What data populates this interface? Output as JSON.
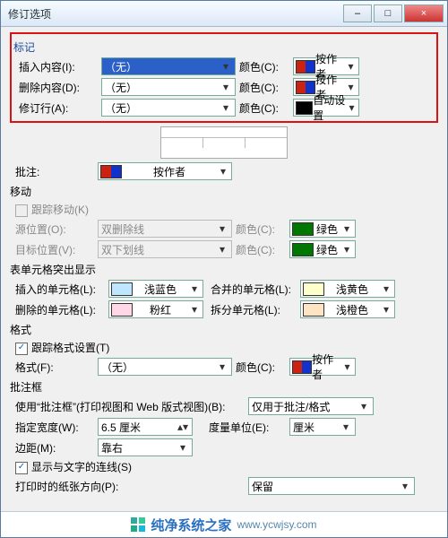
{
  "title": "修订选项",
  "winbuttons": {
    "min": "–",
    "max": "□",
    "close": "×"
  },
  "sections": {
    "mark": "标记",
    "annot": "批注:",
    "move": "移动",
    "cellHighlight": "表单元格突出显示",
    "format": "格式",
    "balloon": "批注框"
  },
  "mark": {
    "insertLbl": "插入内容(I):",
    "insertVal": "（无）",
    "insertColorLbl": "颜色(C):",
    "insertColorTxt": "按作者",
    "deleteLbl": "删除内容(D):",
    "deleteVal": "（无）",
    "deleteColorLbl": "颜色(C):",
    "deleteColorTxt": "按作者",
    "revLbl": "修订行(A):",
    "revVal": "（无）",
    "revColorLbl": "颜色(C):",
    "revColorTxt": "自动设置"
  },
  "annot": {
    "val": "按作者"
  },
  "move": {
    "trackLbl": "跟踪移动(K)",
    "srcLbl": "源位置(O):",
    "srcVal": "双删除线",
    "srcColorLbl": "颜色(C):",
    "srcColorTxt": "绿色",
    "tgtLbl": "目标位置(V):",
    "tgtVal": "双下划线",
    "tgtColorLbl": "颜色(C):",
    "tgtColorTxt": "绿色"
  },
  "cell": {
    "insertedLbl": "插入的单元格(L):",
    "insertedTxt": "浅蓝色",
    "mergedLbl": "合并的单元格(L):",
    "mergedTxt": "浅黄色",
    "deletedLbl": "删除的单元格(L):",
    "deletedTxt": "粉红",
    "splitLbl": "拆分单元格(L):",
    "splitTxt": "浅橙色"
  },
  "format": {
    "trackLbl": "跟踪格式设置(T)",
    "fmtLbl": "格式(F):",
    "fmtVal": "（无）",
    "colorLbl": "颜色(C):",
    "colorTxt": "按作者"
  },
  "balloon": {
    "useLbl": "使用“批注框”(打印视图和 Web 版式视图)(B):",
    "useVal": "仅用于批注/格式",
    "widthLbl": "指定宽度(W):",
    "widthVal": "6.5 厘米",
    "unitLbl": "度量单位(E):",
    "unitVal": "厘米",
    "marginLbl": "边距(M):",
    "marginVal": "靠右",
    "showLinesLbl": "显示与文字的连线(S)",
    "paperLbl": "打印时的纸张方向(P):",
    "paperVal": "保留"
  },
  "watermark": {
    "text": "纯净系统之家",
    "url": "www.ycwjsy.com"
  }
}
